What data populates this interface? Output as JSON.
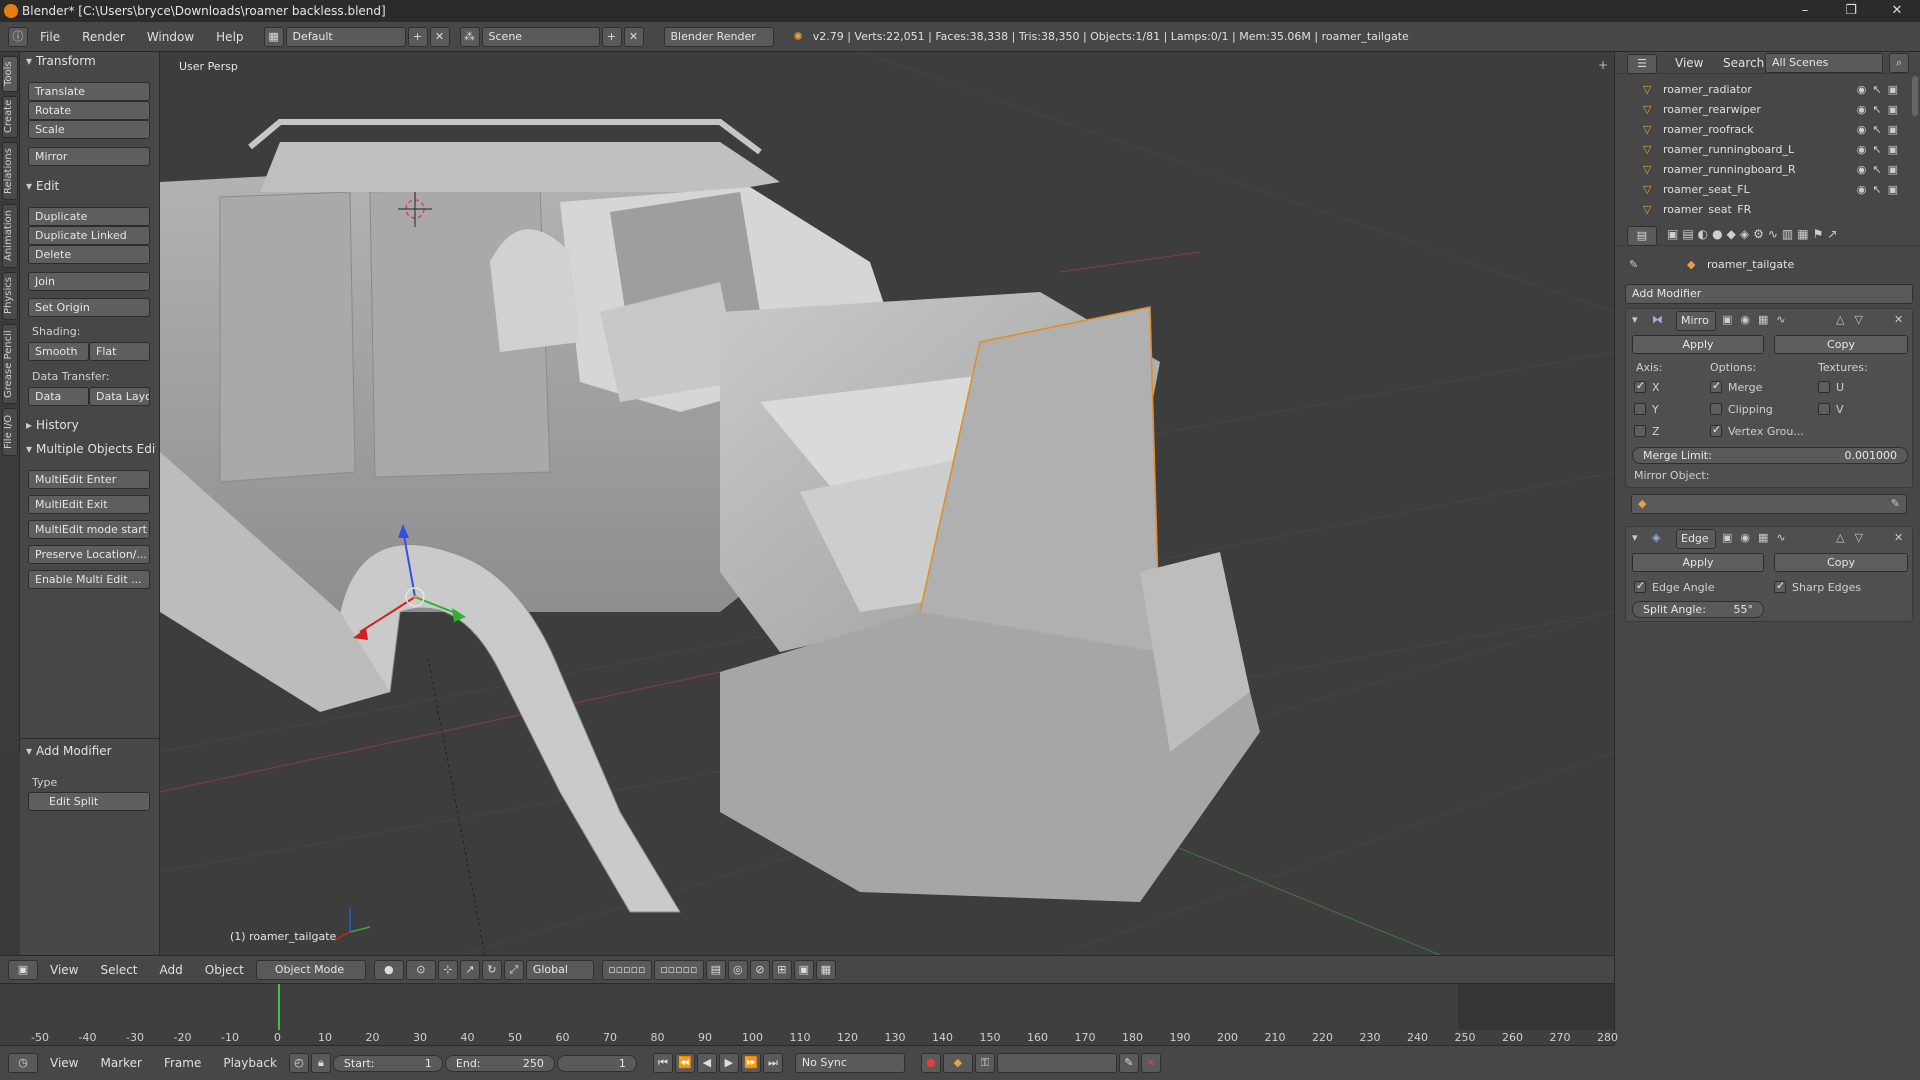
{
  "window": {
    "title": "Blender* [C:\\Users\\bryce\\Downloads\\roamer backless.blend]",
    "controls": [
      "–",
      "❐",
      "✕"
    ]
  },
  "info_header": {
    "menus": [
      "File",
      "Render",
      "Window",
      "Help"
    ],
    "layout": "Default",
    "scene": "Scene",
    "engine": "Blender Render",
    "stats": "v2.79 | Verts:22,051 | Faces:38,338 | Tris:38,350 | Objects:1/81 | Lamps:0/1 | Mem:35.06M | roamer_tailgate"
  },
  "side_tabs": [
    "Tools",
    "Create",
    "Relations",
    "Animation",
    "Physics",
    "Grease Pencil",
    "File I/O"
  ],
  "toolshelf": {
    "transform": {
      "title": "Transform",
      "buttons": [
        "Translate",
        "Rotate",
        "Scale",
        "Mirror"
      ]
    },
    "edit": {
      "title": "Edit",
      "buttons": [
        "Duplicate",
        "Duplicate Linked",
        "Delete",
        "Join",
        "Set Origin"
      ]
    },
    "shading": {
      "label": "Shading:",
      "smooth": "Smooth",
      "flat": "Flat"
    },
    "data_transfer": {
      "label": "Data Transfer:",
      "data": "Data",
      "data_layout": "Data Layo"
    },
    "history": {
      "title": "History"
    },
    "multi": {
      "title": "Multiple Objects Edit",
      "buttons": [
        "MultiEdit Enter",
        "MultiEdit Exit",
        "MultiEdit mode start",
        "Preserve Location/...",
        "Enable Multi Edit ..."
      ]
    },
    "add_modifier": {
      "title": "Add Modifier",
      "type_label": "Type",
      "type_value": "Edit Split"
    }
  },
  "viewport": {
    "view_name": "User Persp",
    "object_label": "(1) roamer_tailgate"
  },
  "viewport_header": {
    "menus": [
      "View",
      "Select",
      "Add",
      "Object"
    ],
    "mode": "Object Mode",
    "orientation": "Global"
  },
  "timeline": {
    "ticks": [
      "-50",
      "-40",
      "-30",
      "-20",
      "-10",
      "0",
      "10",
      "20",
      "30",
      "40",
      "50",
      "60",
      "70",
      "80",
      "90",
      "100",
      "110",
      "120",
      "130",
      "140",
      "150",
      "160",
      "170",
      "180",
      "190",
      "200",
      "210",
      "220",
      "230",
      "240",
      "250",
      "260",
      "270",
      "280"
    ],
    "current_frame_marker": "0"
  },
  "timeline_header": {
    "menus": [
      "View",
      "Marker",
      "Frame",
      "Playback"
    ],
    "start_label": "Start:",
    "start_value": "1",
    "end_label": "End:",
    "end_value": "250",
    "current": "1",
    "sync": "No Sync"
  },
  "outliner": {
    "menus": [
      "View",
      "Search"
    ],
    "scenes": "All Scenes",
    "items": [
      "roamer_radiator",
      "roamer_rearwiper",
      "roamer_roofrack",
      "roamer_runningboard_L",
      "roamer_runningboard_R",
      "roamer_seat_FL",
      "roamer_seat_FR"
    ]
  },
  "properties": {
    "object_name": "roamer_tailgate",
    "add_modifier": "Add Modifier",
    "mirror": {
      "name": "Mirro",
      "apply": "Apply",
      "copy": "Copy",
      "axis_label": "Axis:",
      "options_label": "Options:",
      "textures_label": "Textures:",
      "x": "X",
      "y": "Y",
      "z": "Z",
      "merge": "Merge",
      "clipping": "Clipping",
      "vertex_groups": "Vertex Grou...",
      "u": "U",
      "v": "V",
      "merge_limit_label": "Merge Limit:",
      "merge_limit_value": "0.001000",
      "mirror_object_label": "Mirror Object:"
    },
    "edge": {
      "name": "Edge",
      "apply": "Apply",
      "copy": "Copy",
      "edge_angle": "Edge Angle",
      "sharp_edges": "Sharp Edges",
      "split_angle_label": "Split Angle:",
      "split_angle_value": "55°"
    }
  }
}
